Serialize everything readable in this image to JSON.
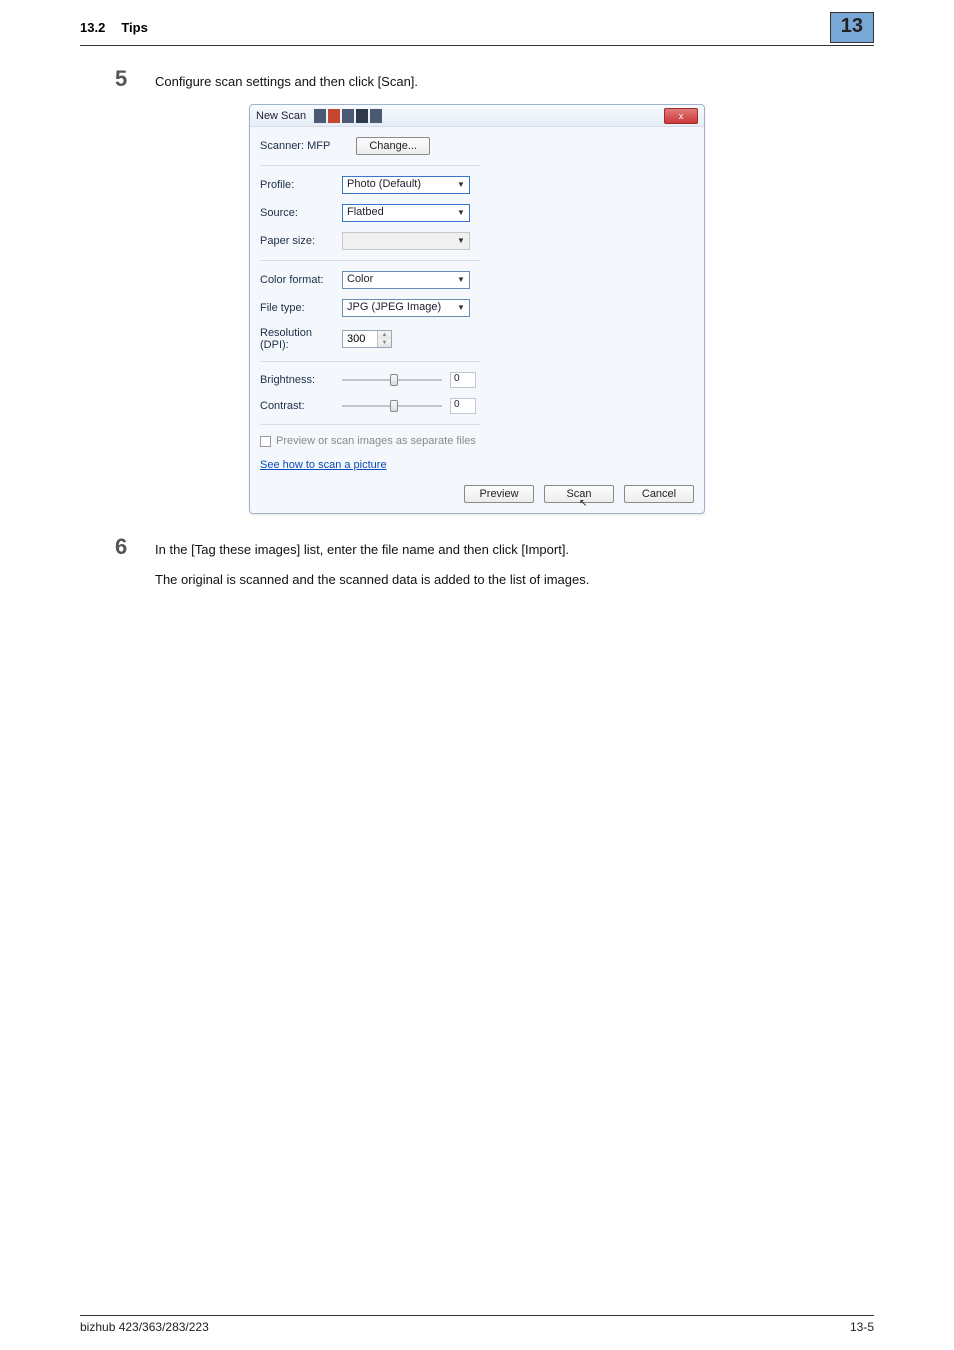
{
  "header": {
    "section_no": "13.2",
    "section_title": "Tips",
    "chapter": "13"
  },
  "steps": {
    "s5": {
      "num": "5",
      "text": "Configure scan settings and then click [Scan]."
    },
    "s6": {
      "num": "6",
      "text": "In the [Tag these images] list, enter the file name and then click [Import].",
      "sub": "The original is scanned and the scanned data is added to the list of images."
    }
  },
  "dialog": {
    "title": "New Scan",
    "close": "x",
    "scanner_label": "Scanner: MFP",
    "change_btn": "Change...",
    "profile_label": "Profile:",
    "profile_value": "Photo (Default)",
    "source_label": "Source:",
    "source_value": "Flatbed",
    "papersize_label": "Paper size:",
    "papersize_value": "",
    "colorformat_label": "Color format:",
    "colorformat_value": "Color",
    "filetype_label": "File type:",
    "filetype_value": "JPG (JPEG Image)",
    "resolution_label": "Resolution (DPI):",
    "resolution_value": "300",
    "brightness_label": "Brightness:",
    "brightness_value": "0",
    "contrast_label": "Contrast:",
    "contrast_value": "0",
    "separate_files": "Preview or scan images as separate files",
    "help_link": "See how to scan a picture",
    "preview_btn": "Preview",
    "scan_btn": "Scan",
    "cancel_btn": "Cancel"
  },
  "footer": {
    "left": "bizhub 423/363/283/223",
    "right": "13-5"
  }
}
